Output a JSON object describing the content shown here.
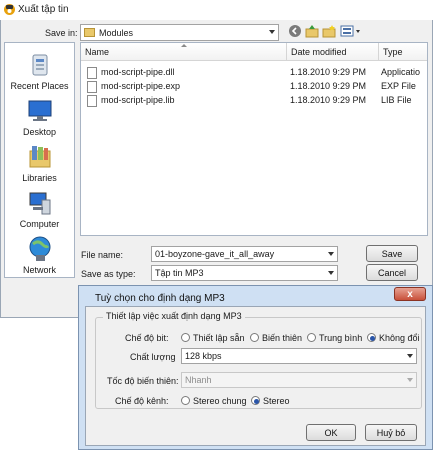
{
  "window": {
    "title": "Xuất tập tin"
  },
  "save_in": {
    "label": "Save in:",
    "value": "Modules"
  },
  "places": [
    {
      "label": "Recent Places",
      "icon": "recent-places-icon"
    },
    {
      "label": "Desktop",
      "icon": "desktop-icon"
    },
    {
      "label": "Libraries",
      "icon": "libraries-icon"
    },
    {
      "label": "Computer",
      "icon": "computer-icon"
    },
    {
      "label": "Network",
      "icon": "network-icon"
    }
  ],
  "file_list": {
    "columns": [
      "Name",
      "Date modified",
      "Type"
    ],
    "rows": [
      {
        "name": "mod-script-pipe.dll",
        "date": "1.18.2010 9:29 PM",
        "type": "Applicatio"
      },
      {
        "name": "mod-script-pipe.exp",
        "date": "1.18.2010 9:29 PM",
        "type": "EXP File"
      },
      {
        "name": "mod-script-pipe.lib",
        "date": "1.18.2010 9:29 PM",
        "type": "LIB File"
      }
    ]
  },
  "file_name": {
    "label": "File name:",
    "value": "01-boyzone-gave_it_all_away"
  },
  "save_as_type": {
    "label": "Save as type:",
    "value": "Tập tin MP3"
  },
  "buttons": {
    "save": "Save",
    "cancel": "Cancel",
    "ok": "OK",
    "cancel_vi": "Huỷ bỏ"
  },
  "dialog": {
    "title": "Tuỳ chọn cho định dạng MP3",
    "close": "x",
    "group_title": "Thiết lập việc xuất định dạng MP3",
    "bitrate_mode": {
      "label": "Chế độ bit:",
      "options": [
        "Thiết lập sẵn",
        "Biến thiên",
        "Trung bình",
        "Không đổi"
      ],
      "selected": "Không đổi"
    },
    "quality": {
      "label": "Chất lượng",
      "value": "128 kbps"
    },
    "variable_speed": {
      "label": "Tốc độ biến thiên:",
      "value": "Nhanh"
    },
    "channel_mode": {
      "label": "Chế độ kênh:",
      "options": [
        "Stereo chung",
        "Stereo"
      ],
      "selected": "Stereo"
    }
  }
}
